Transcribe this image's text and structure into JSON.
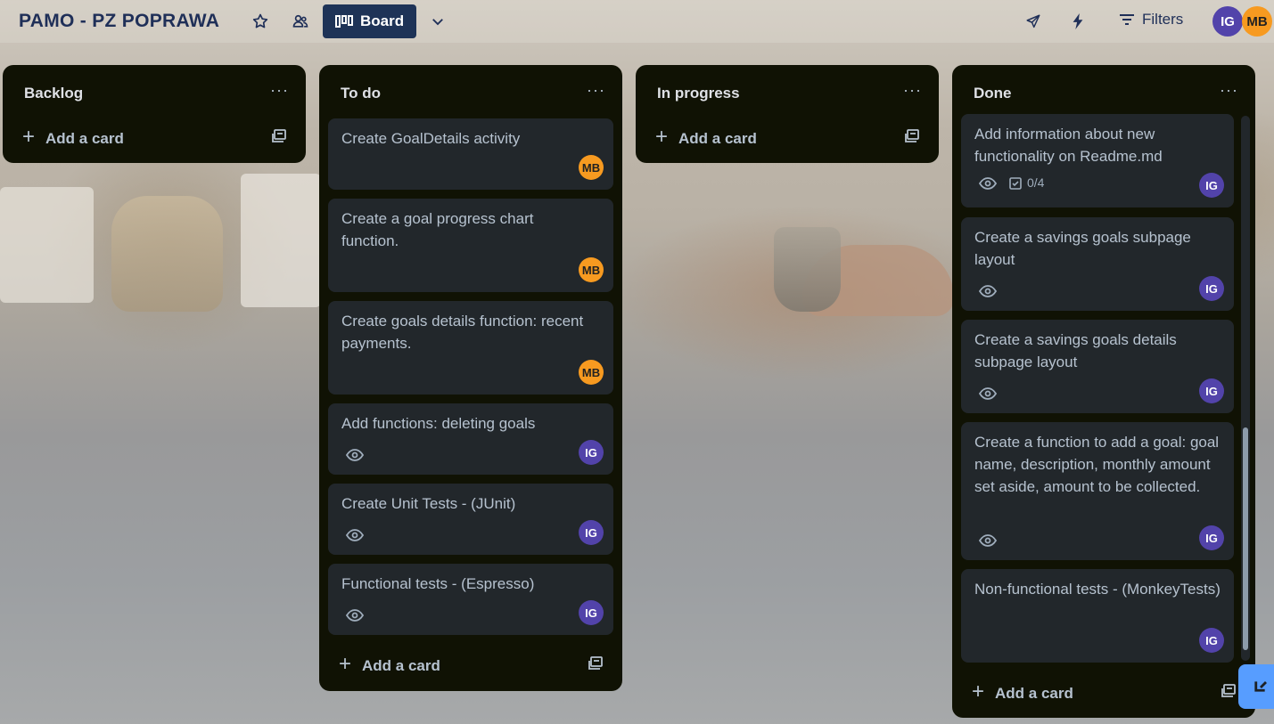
{
  "header": {
    "board_title": "PAMO - PZ POPRAWA",
    "view_button": "Board",
    "filters_label": "Filters",
    "members": [
      "IG",
      "MB"
    ]
  },
  "lists": [
    {
      "title": "Backlog",
      "add_card": "Add a card",
      "cards": []
    },
    {
      "title": "To do",
      "add_card": "Add a card",
      "cards": [
        {
          "title": "Create GoalDetails activity",
          "member": "MB",
          "watch": false
        },
        {
          "title": "Create a goal progress chart function.",
          "member": "MB",
          "watch": false
        },
        {
          "title": "Create goals details function: recent payments.",
          "member": "MB",
          "watch": false
        },
        {
          "title": "Add functions: deleting goals",
          "member": "IG",
          "watch": true
        },
        {
          "title": "Create Unit Tests - (JUnit)",
          "member": "IG",
          "watch": true
        },
        {
          "title": "Functional tests - (Espresso)",
          "member": "IG",
          "watch": true
        }
      ]
    },
    {
      "title": "In progress",
      "add_card": "Add a card",
      "cards": []
    },
    {
      "title": "Done",
      "add_card": "Add a card",
      "cards": [
        {
          "title": "Add information about new functionality on Readme.md",
          "member": "IG",
          "watch": true,
          "checklist": "0/4"
        },
        {
          "title": "Create a savings goals subpage layout",
          "member": "IG",
          "watch": true
        },
        {
          "title": "Create a savings goals details subpage layout",
          "member": "IG",
          "watch": true
        },
        {
          "title": "Create a function to add a goal: goal name, description, monthly amount set aside, amount to be collected.",
          "member": "IG",
          "watch": true
        },
        {
          "title": "Non-functional tests - (MonkeyTests)",
          "member": "IG",
          "watch": false
        }
      ]
    }
  ],
  "list_menu_glyph": "···",
  "colors": {
    "header_text": "#1f2f58",
    "board_button_bg": "#1e3357",
    "list_bg": "#101204",
    "card_bg": "#22272b",
    "avatar_ig": "#5243aa",
    "avatar_mb": "#f79a20",
    "float_button": "#579dff"
  }
}
